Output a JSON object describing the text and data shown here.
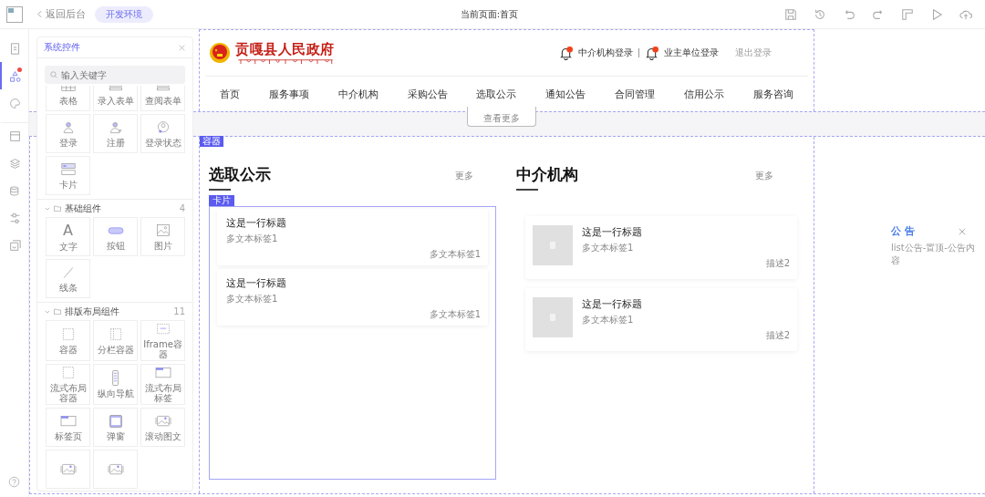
{
  "toolbar": {
    "back": "返回后台",
    "env_tag": "开发环境",
    "current_page": "当前页面:首页",
    "actions": [
      {
        "kind": "save"
      },
      {
        "kind": "history"
      },
      {
        "kind": "undo"
      },
      {
        "kind": "redo"
      },
      {
        "kind": "frame"
      },
      {
        "kind": "play"
      },
      {
        "kind": "upload"
      }
    ]
  },
  "rail": [
    {
      "kind": "page",
      "selected": false,
      "badge": false
    },
    {
      "kind": "components",
      "selected": true,
      "badge": true
    },
    {
      "kind": "palette",
      "selected": false,
      "badge": false
    },
    {
      "kind": "layout",
      "selected": false,
      "badge": false
    },
    {
      "kind": "layers",
      "selected": false,
      "badge": false
    },
    {
      "kind": "database",
      "selected": false,
      "badge": false
    },
    {
      "kind": "settings",
      "selected": false,
      "badge": false
    },
    {
      "kind": "frame",
      "selected": false,
      "badge": false
    }
  ],
  "panel": {
    "title": "系统控件",
    "search_placeholder": "输入关键字",
    "groups": [
      {
        "items": [
          {
            "label": "表格",
            "kind": "table"
          },
          {
            "label": "录入表单",
            "kind": "form"
          },
          {
            "label": "查阅表单",
            "kind": "form"
          },
          {
            "label": "登录",
            "kind": "user"
          },
          {
            "label": "注册",
            "kind": "user-add"
          },
          {
            "label": "登录状态",
            "kind": "user-circle"
          },
          {
            "label": "卡片",
            "kind": "card"
          }
        ]
      },
      {
        "title": "基础组件",
        "count": "4",
        "expanded": true,
        "items": [
          {
            "label": "文字",
            "kind": "glyph",
            "glyph": "A"
          },
          {
            "label": "按钮",
            "kind": "pill"
          },
          {
            "label": "图片",
            "kind": "image"
          },
          {
            "label": "线条",
            "kind": "line"
          }
        ]
      },
      {
        "title": "排版布局组件",
        "count": "11",
        "expanded": true,
        "items": [
          {
            "label": "容器",
            "kind": "dashed"
          },
          {
            "label": "分栏容器",
            "kind": "columns"
          },
          {
            "label": "Iframe容器",
            "kind": "iframe"
          },
          {
            "label": "流式布局容器",
            "kind": "dashed"
          },
          {
            "label": "纵向导航",
            "kind": "vnav"
          },
          {
            "label": "流式布局标签",
            "kind": "tabs"
          },
          {
            "label": "标签页",
            "kind": "tabs"
          },
          {
            "label": "弹窗",
            "kind": "dialog"
          },
          {
            "label": "滚动图文",
            "kind": "carousel"
          },
          {
            "kind": "carousel"
          },
          {
            "kind": "carousel"
          }
        ]
      }
    ]
  },
  "site": {
    "title": "贡嘎县人民政府",
    "alerts": [
      {
        "link": "中介机构登录"
      },
      {
        "link": "业主单位登录"
      }
    ],
    "logout": "退出登录",
    "nav": [
      "首页",
      "服务事项",
      "中介机构",
      "采购公告",
      "选取公示",
      "通知公告",
      "合同管理",
      "信用公示",
      "服务咨询"
    ]
  },
  "more_button": "查看更多",
  "container_tag": "容器",
  "card_tag": "卡片",
  "sections": [
    {
      "title": "选取公示",
      "more": "更多",
      "kind": "text",
      "items": [
        {
          "title": "这是一行标题",
          "subtitle": "多文本标签1",
          "meta": "多文本标签1"
        },
        {
          "title": "这是一行标题",
          "subtitle": "多文本标签1",
          "meta": "多文本标签1"
        }
      ]
    },
    {
      "title": "中介机构",
      "more": "更多",
      "kind": "image",
      "items": [
        {
          "title": "这是一行标题",
          "subtitle": "多文本标签1",
          "meta": "描述2"
        },
        {
          "title": "这是一行标题",
          "subtitle": "多文本标签1",
          "meta": "描述2"
        }
      ]
    }
  ],
  "notice": {
    "title": "公 告",
    "body": "list公告-置顶-公告内容"
  }
}
